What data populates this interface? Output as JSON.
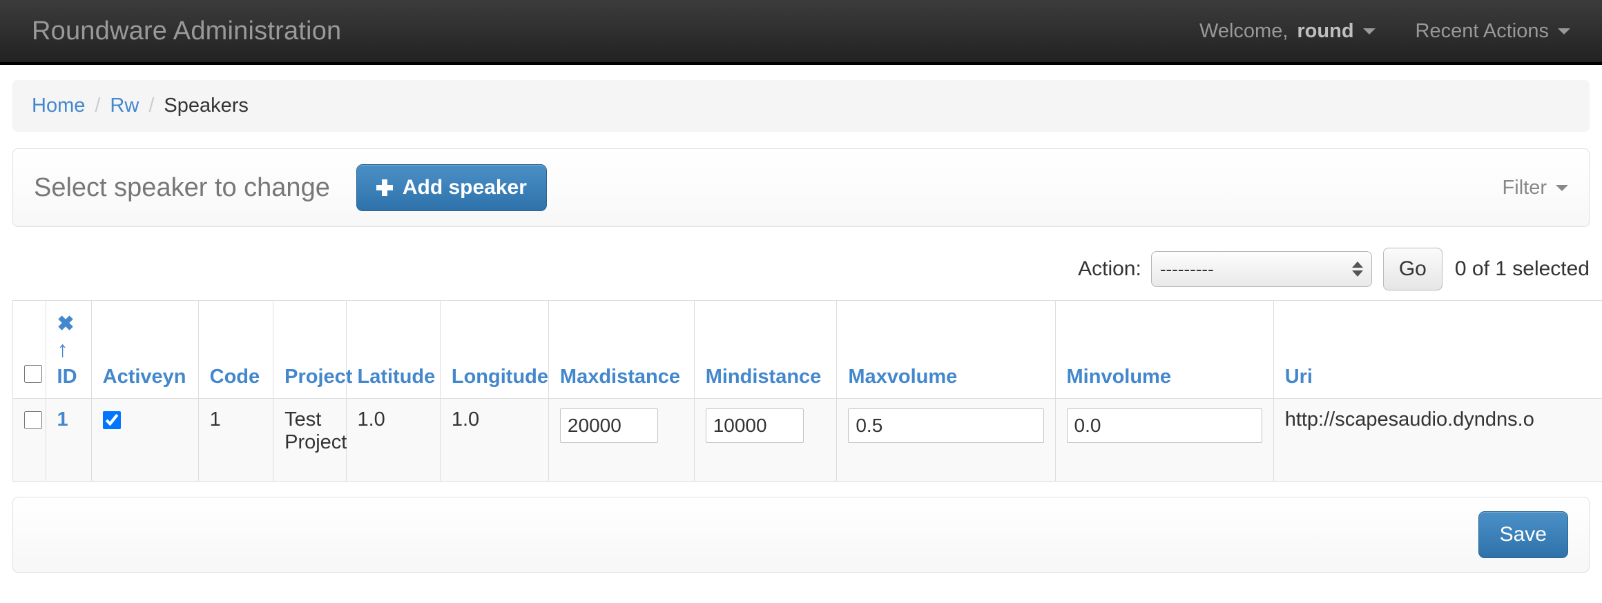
{
  "navbar": {
    "brand": "Roundware Administration",
    "welcome_prefix": "Welcome,",
    "username": "round",
    "recent_actions": "Recent Actions"
  },
  "breadcrumb": {
    "home": "Home",
    "app": "Rw",
    "current": "Speakers",
    "separator": "/"
  },
  "title_panel": {
    "title": "Select speaker to change",
    "add_button": "Add speaker",
    "filter_label": "Filter"
  },
  "action_bar": {
    "label": "Action:",
    "selected_option": "---------",
    "options": [
      "---------"
    ],
    "go_button": "Go",
    "selection_status": "0 of 1 selected"
  },
  "table": {
    "columns": [
      "ID",
      "Activeyn",
      "Code",
      "Project",
      "Latitude",
      "Longitude",
      "Maxdistance",
      "Mindistance",
      "Maxvolume",
      "Minvolume",
      "Uri"
    ],
    "sort_icons": {
      "remove_sort": "✖",
      "ascending": "↑"
    },
    "rows": [
      {
        "selected": false,
        "id": "1",
        "activeyn": true,
        "code": "1",
        "project": "Test Project",
        "latitude": "1.0",
        "longitude": "1.0",
        "maxdistance": "20000",
        "mindistance": "10000",
        "maxvolume": "0.5",
        "minvolume": "0.0",
        "uri": "http://scapesaudio.dyndns.o"
      }
    ]
  },
  "bottom_bar": {
    "save_button": "Save"
  },
  "colors": {
    "link_blue": "#4387cd",
    "button_blue": "#2f72ab",
    "navbar_dark": "#2b2b2b",
    "breadcrumb_bg": "#f5f5f5"
  }
}
